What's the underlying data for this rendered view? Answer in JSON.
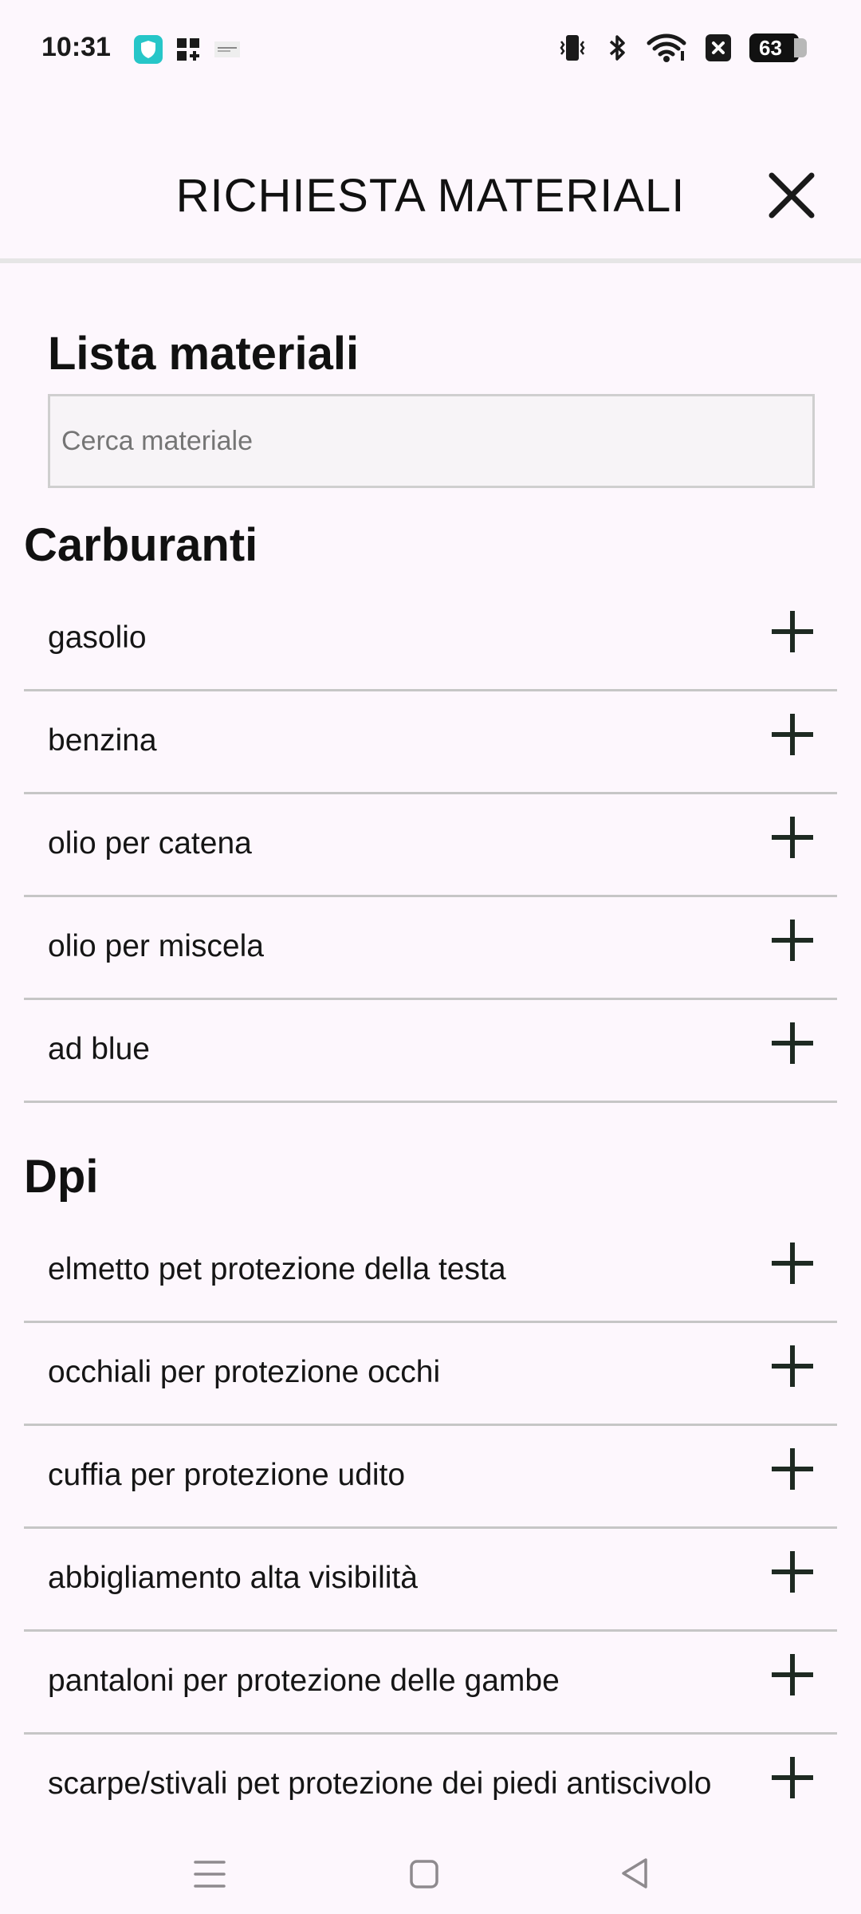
{
  "status": {
    "time": "10:31",
    "battery": "63",
    "icons": [
      "shield-app-icon",
      "widget-grid-icon",
      "notification-thumb-icon",
      "vibrate-icon",
      "bluetooth-icon",
      "wifi-icon",
      "close-box-icon",
      "battery-icon"
    ]
  },
  "header": {
    "title": "RICHIESTA MATERIALI"
  },
  "main": {
    "section_title": "Lista materiali",
    "search_placeholder": "Cerca materiale"
  },
  "categories": [
    {
      "name": "Carburanti",
      "items": [
        "gasolio",
        "benzina",
        "olio per catena",
        "olio per miscela",
        "ad blue"
      ]
    },
    {
      "name": "Dpi",
      "items": [
        "elmetto pet protezione della testa",
        "occhiali per protezione occhi",
        "cuffia per protezione udito",
        "abbigliamento alta visibilità",
        "pantaloni per protezione delle gambe",
        "scarpe/stivali pet protezione dei piedi antiscivolo"
      ]
    }
  ],
  "colors": {
    "background": "#FDF7FD",
    "divider": "#C6C6C6",
    "plus_icon": "#1E2A22"
  }
}
